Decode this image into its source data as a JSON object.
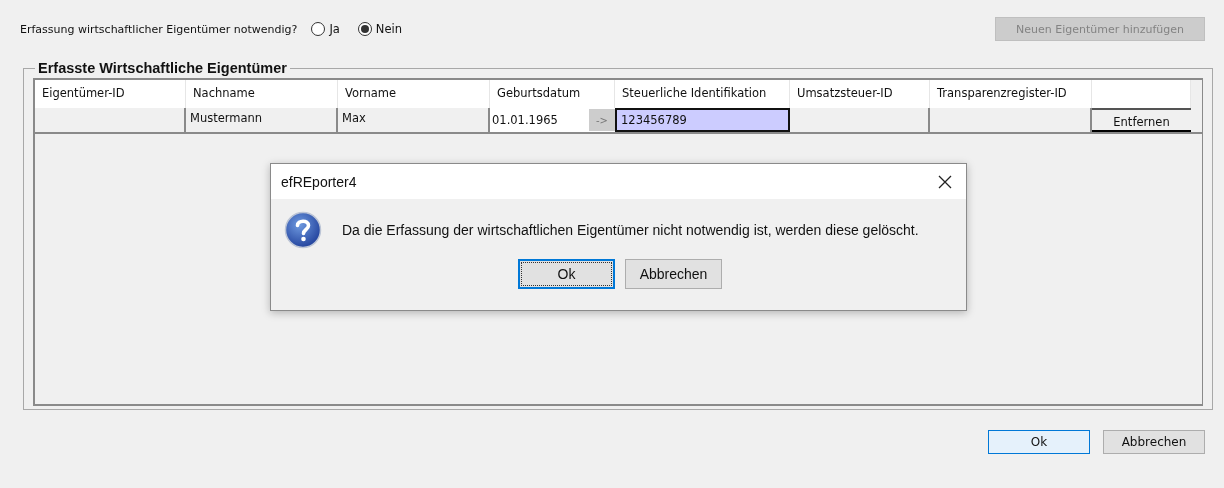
{
  "question": {
    "label": "Erfassung wirtschaftlicher Eigentümer notwendig?",
    "options": [
      {
        "label": "Ja",
        "selected": false
      },
      {
        "label": "Nein",
        "selected": true
      }
    ]
  },
  "add_button": {
    "label": "Neuen Eigentümer hinzufügen",
    "disabled": true
  },
  "group": {
    "title": "Erfasste Wirtschaftliche Eigentümer",
    "columns": [
      "Eigentümer-ID",
      "Nachname",
      "Vorname",
      "Geburtsdatum",
      "Steuerliche Identifikation",
      "Umsatzsteuer-ID",
      "Transparenzregister-ID"
    ],
    "rows": [
      {
        "cells": [
          {
            "kind": "blank"
          },
          {
            "kind": "text",
            "text": "Mustermann"
          },
          {
            "kind": "text",
            "text": "Max"
          },
          {
            "kind": "date",
            "text": "01.01.1965",
            "button": "->"
          },
          {
            "kind": "input",
            "value": "123456789",
            "focused": true
          },
          {
            "kind": "blank"
          },
          {
            "kind": "blank"
          },
          {
            "kind": "button",
            "label": "Entfernen"
          }
        ]
      }
    ]
  },
  "dialog": {
    "title": "efREporter4",
    "message": "Da die Erfassung der wirtschaftlichen Eigentümer nicht notwendig ist, werden diese gelöscht.",
    "buttons": [
      {
        "label": "Ok",
        "focused": true
      },
      {
        "label": "Abbrechen",
        "focused": false
      }
    ]
  },
  "footer_buttons": [
    {
      "label": "Ok",
      "focused": true
    },
    {
      "label": "Abbrechen",
      "focused": false
    }
  ]
}
